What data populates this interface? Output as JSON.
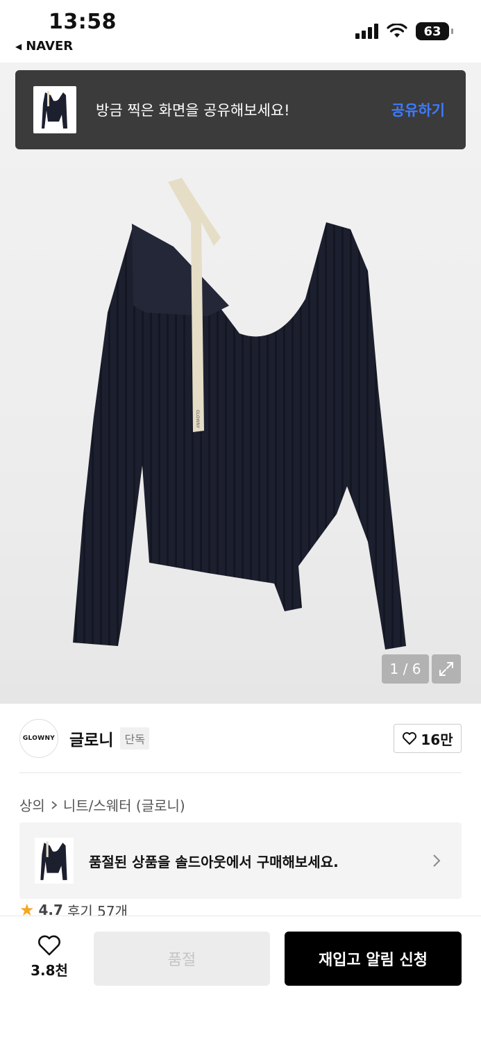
{
  "status_bar": {
    "time": "13:58",
    "back_app": "NAVER",
    "back_icon": "triangle-left-icon",
    "battery": "63"
  },
  "share_toast": {
    "text": "방금 찍은 화면을 공유해보세요!",
    "action": "공유하기",
    "action_color": "#3d7bff"
  },
  "gallery": {
    "counter": "1 / 6",
    "tag_text": "GLOWNY"
  },
  "brand": {
    "logo_text": "GLOWNY",
    "name": "글로니",
    "tag": "단독",
    "likes": "16만"
  },
  "breadcrumb": {
    "items": [
      "상의",
      "니트/스웨터 (글로니)"
    ]
  },
  "soldout_banner": {
    "text": "품절된 상품을 솔드아웃에서 구매해보세요."
  },
  "rating": {
    "score": "4.7",
    "reviews": "후기 57개"
  },
  "bottom_bar": {
    "wish_count": "3.8천",
    "soldout_label": "품절",
    "restock_label": "재입고 알림 신청"
  }
}
